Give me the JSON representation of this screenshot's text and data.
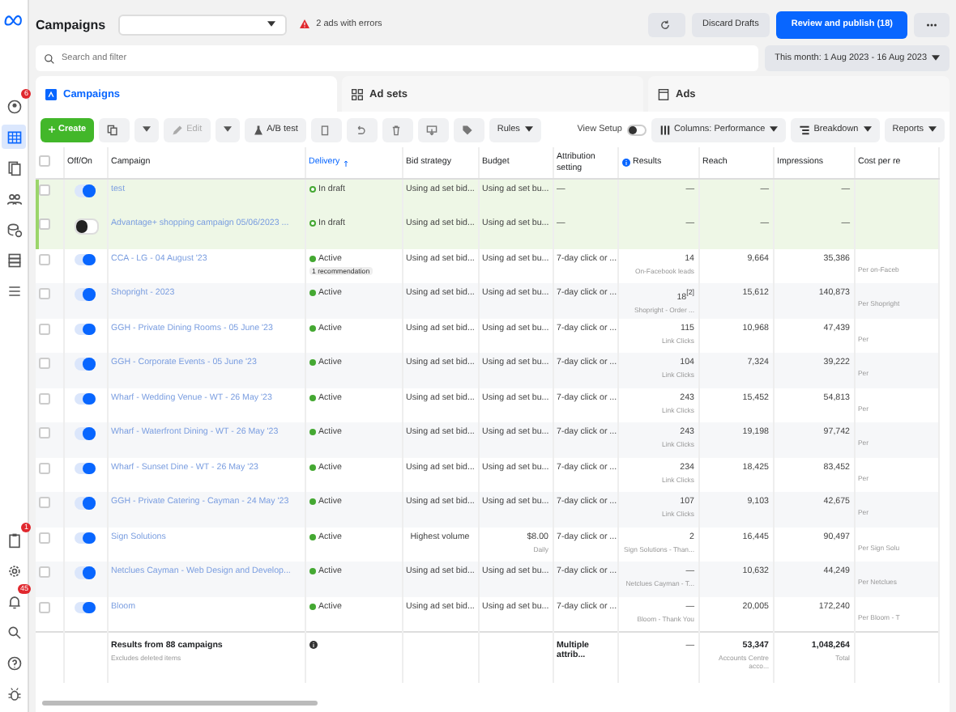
{
  "header": {
    "title": "Campaigns",
    "warning": "2 ads with errors",
    "buttons": [
      {
        "label": "Discard Drafts",
        "kind": "plain"
      },
      {
        "label": "Review and publish (18)",
        "kind": "primary"
      }
    ]
  },
  "search": {
    "placeholder": "Search and filter",
    "date_range": "This month: 1 Aug 2023 - 16 Aug 2023"
  },
  "sidebar": {
    "top": [
      {
        "kind": "profile",
        "badge": "6",
        "selected": false
      },
      {
        "kind": "table",
        "selected": true
      },
      {
        "kind": "pages",
        "selected": false
      },
      {
        "kind": "people",
        "selected": false
      },
      {
        "kind": "coins",
        "selected": false
      },
      {
        "kind": "stack",
        "selected": false
      },
      {
        "kind": "menu",
        "selected": false
      }
    ],
    "bottom": [
      {
        "kind": "clipboard",
        "badge": "1"
      },
      {
        "kind": "gear"
      },
      {
        "kind": "bell",
        "badge": "45"
      },
      {
        "kind": "search"
      },
      {
        "kind": "help"
      },
      {
        "kind": "bug"
      }
    ]
  },
  "tabs": [
    {
      "label": "Campaigns",
      "kind": "campaign",
      "selected": true
    },
    {
      "label": "Ad sets",
      "kind": "adsets",
      "selected": false
    },
    {
      "label": "Ads",
      "kind": "ads",
      "selected": false
    }
  ],
  "toolbar": {
    "create": "Create",
    "edit": "Edit",
    "ab_test": "A/B test",
    "rules": "Rules",
    "view_setup": "View Setup",
    "view_setup_on": false,
    "columns": "Columns: Performance",
    "breakdown": "Breakdown",
    "reports": "Reports"
  },
  "table": {
    "all_selected": false,
    "columns": [
      "Off/On",
      "Campaign",
      "Delivery",
      "Bid strategy",
      "Budget",
      "Attribution setting",
      "Results",
      "Reach",
      "Impressions",
      "Cost per re"
    ],
    "rows": [
      {
        "selected": false,
        "on": true,
        "draft": true,
        "campaign": "test",
        "delivery": "In draft",
        "kind": "draft",
        "bid": "Using ad set bid...",
        "budget": "Using ad set bu...",
        "attribution": "—",
        "results": "—",
        "reach": "—",
        "impressions": "—"
      },
      {
        "selected": false,
        "on": false,
        "draft": true,
        "campaign": "Advantage+ shopping campaign 05/06/2023 ...",
        "delivery": "In draft",
        "kind": "draft",
        "bid": "Using ad set bid...",
        "budget": "Using ad set bu...",
        "attribution": "—",
        "results": "—",
        "reach": "—",
        "impressions": "—"
      },
      {
        "selected": false,
        "on": true,
        "draft": false,
        "campaign": "CCA - LG - 04 August '23",
        "delivery": "Active",
        "kind": "active",
        "recommendation": "1 recommendation",
        "bid": "Using ad set bid...",
        "budget": "Using ad set bu...",
        "attribution": "7-day click or ...",
        "results": "14",
        "results_sub": "On-Facebook leads",
        "reach": "9,664",
        "impressions": "35,386",
        "cost_sub": "Per on-Faceb"
      },
      {
        "selected": false,
        "on": true,
        "draft": false,
        "campaign": "Shopright - 2023",
        "delivery": "Active",
        "kind": "active",
        "bid": "Using ad set bid...",
        "budget": "Using ad set bu...",
        "attribution": "7-day click or ...",
        "results": "18$^{[2]}$",
        "results_sub": "Shopright - Order ...",
        "reach": "15,612",
        "impressions": "140,873",
        "cost_sub": "Per Shopright"
      },
      {
        "selected": false,
        "on": true,
        "draft": false,
        "campaign": "GGH - Private Dining Rooms - 05 June '23",
        "delivery": "Active",
        "kind": "active",
        "bid": "Using ad set bid...",
        "budget": "Using ad set bu...",
        "attribution": "7-day click or ...",
        "results": "115",
        "results_sub": "Link Clicks",
        "reach": "10,968",
        "impressions": "47,439",
        "cost_sub": "Per"
      },
      {
        "selected": false,
        "on": true,
        "draft": false,
        "campaign": "GGH - Corporate Events - 05 June '23",
        "delivery": "Active",
        "kind": "active",
        "bid": "Using ad set bid...",
        "budget": "Using ad set bu...",
        "attribution": "7-day click or ...",
        "results": "104",
        "results_sub": "Link Clicks",
        "reach": "7,324",
        "impressions": "39,222",
        "cost_sub": "Per"
      },
      {
        "selected": false,
        "on": true,
        "draft": false,
        "campaign": "Wharf - Wedding Venue - WT - 26 May '23",
        "delivery": "Active",
        "kind": "active",
        "bid": "Using ad set bid...",
        "budget": "Using ad set bu...",
        "attribution": "7-day click or ...",
        "results": "243",
        "results_sub": "Link Clicks",
        "reach": "15,452",
        "impressions": "54,813",
        "cost_sub": "Per"
      },
      {
        "selected": false,
        "on": true,
        "draft": false,
        "campaign": "Wharf - Waterfront Dining - WT - 26 May '23",
        "delivery": "Active",
        "kind": "active",
        "bid": "Using ad set bid...",
        "budget": "Using ad set bu...",
        "attribution": "7-day click or ...",
        "results": "243",
        "results_sub": "Link Clicks",
        "reach": "19,198",
        "impressions": "97,742",
        "cost_sub": "Per"
      },
      {
        "selected": false,
        "on": true,
        "draft": false,
        "campaign": "Wharf - Sunset Dine - WT - 26 May '23",
        "delivery": "Active",
        "kind": "active",
        "bid": "Using ad set bid...",
        "budget": "Using ad set bu...",
        "attribution": "7-day click or ...",
        "results": "234",
        "results_sub": "Link Clicks",
        "reach": "18,425",
        "impressions": "83,452",
        "cost_sub": "Per"
      },
      {
        "selected": false,
        "on": true,
        "draft": false,
        "campaign": "GGH - Private Catering - Cayman - 24 May '23",
        "delivery": "Active",
        "kind": "active",
        "bid": "Using ad set bid...",
        "budget": "Using ad set bu...",
        "attribution": "7-day click or ...",
        "results": "107",
        "results_sub": "Link Clicks",
        "reach": "9,103",
        "impressions": "42,675",
        "cost_sub": "Per"
      },
      {
        "selected": false,
        "on": true,
        "draft": false,
        "campaign": "Sign Solutions",
        "delivery": "Active",
        "kind": "active",
        "bid": "Highest volume",
        "budget": "$8.00",
        "budget_sub": "Daily",
        "attribution": "7-day click or ...",
        "results": "2",
        "results_sub": "Sign Solutions - Than...",
        "reach": "16,445",
        "impressions": "90,497",
        "cost_sub": "Per Sign Solu"
      },
      {
        "selected": false,
        "on": true,
        "draft": false,
        "campaign": "Netclues Cayman - Web Design and Develop...",
        "delivery": "Active",
        "kind": "active",
        "bid": "Using ad set bid...",
        "budget": "Using ad set bu...",
        "attribution": "7-day click or ...",
        "results": "—",
        "results_sub": "Netclues Cayman - T...",
        "reach": "10,632",
        "impressions": "44,249",
        "cost_sub": "Per Netclues"
      },
      {
        "selected": false,
        "on": true,
        "draft": false,
        "campaign": "Bloom",
        "delivery": "Active",
        "kind": "active",
        "bid": "Using ad set bid...",
        "budget": "Using ad set bu...",
        "attribution": "7-day click or ...",
        "results": "—",
        "results_sub": "Bloom - Thank You",
        "reach": "20,005",
        "impressions": "172,240",
        "cost_sub": "Per Bloom - T"
      }
    ],
    "footer": {
      "title": "Results from 88 campaigns",
      "note": "Excludes deleted items",
      "attribution": "Multiple attrib...",
      "results": "—",
      "reach": "53,347",
      "reach_sub": "Accounts Centre acco...",
      "impressions": "1,048,264",
      "impressions_sub": "Total"
    }
  }
}
